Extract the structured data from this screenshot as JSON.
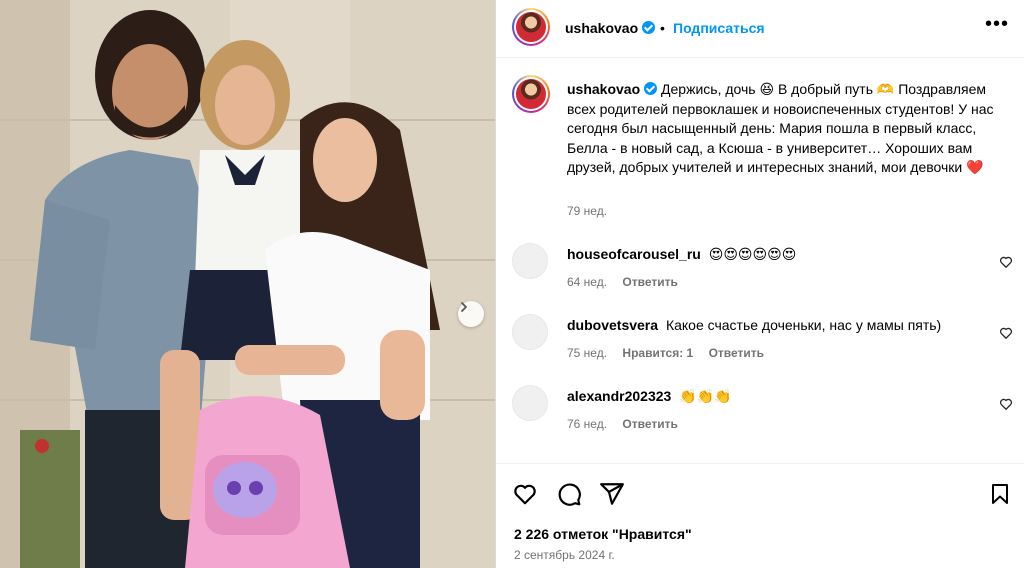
{
  "post": {
    "username": "ushakovao",
    "follow_label": "Подписаться",
    "separator": "•",
    "more_label": "•••",
    "caption_username": "ushakovao",
    "caption_text": "Держись, дочь 😆 В добрый путь 🫶 Поздравляем всех родителей первоклашек и новоиспеченных студентов! У нас сегодня был насыщенный день: Мария пошла в первый класс, Белла - в новый сад, а Ксюша - в университет… Хороших вам друзей, добрых учителей и интересных знаний, мои девочки ❤️",
    "caption_time": "79 нед.",
    "likes": "2 226 отметок \"Нравится\"",
    "date": "2 сентябрь 2024 г."
  },
  "comments": [
    {
      "username": "houseofcarousel_ru",
      "text": "😍😍😍😍😍😍",
      "time": "64 нед.",
      "likes": "",
      "reply": "Ответить"
    },
    {
      "username": "dubovetsvera",
      "text": "Какое счастье доченьки, нас у мамы пять)",
      "time": "75 нед.",
      "likes": "Нравится: 1",
      "reply": "Ответить"
    },
    {
      "username": "alexandr202323",
      "text": "👏👏👏",
      "time": "76 нед.",
      "likes": "",
      "reply": "Ответить"
    }
  ],
  "icons": {
    "verified": "verified-badge-icon",
    "like": "heart-icon",
    "comment": "comment-icon",
    "share": "send-icon",
    "save": "bookmark-icon",
    "next": "chevron-right-icon"
  },
  "colors": {
    "accent": "#0095f6",
    "muted": "#737373"
  }
}
